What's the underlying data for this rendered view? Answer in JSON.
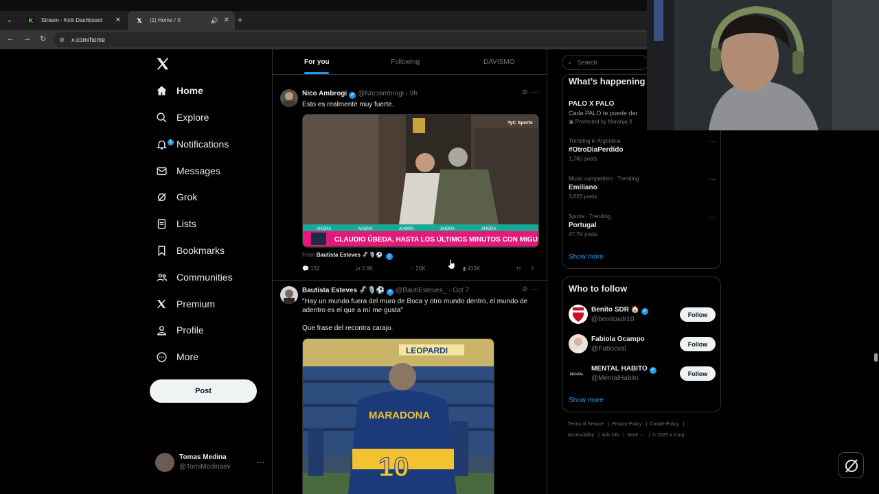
{
  "browser": {
    "tabs": [
      {
        "title": "Stream - Kick Dashboard",
        "favicon": "kick-icon"
      },
      {
        "title": "(1) Home / X",
        "favicon": "x-logo-icon",
        "active": true
      }
    ],
    "url": "x.com/home"
  },
  "sidebar": {
    "items": [
      {
        "label": "Home",
        "icon": "home-icon"
      },
      {
        "label": "Explore",
        "icon": "search-icon"
      },
      {
        "label": "Notifications",
        "icon": "bell-icon",
        "badge": "1"
      },
      {
        "label": "Messages",
        "icon": "envelope-icon"
      },
      {
        "label": "Grok",
        "icon": "grok-icon"
      },
      {
        "label": "Lists",
        "icon": "list-icon"
      },
      {
        "label": "Bookmarks",
        "icon": "bookmark-icon"
      },
      {
        "label": "Communities",
        "icon": "people-icon"
      },
      {
        "label": "Premium",
        "icon": "x-logo-icon"
      },
      {
        "label": "Profile",
        "icon": "person-icon"
      },
      {
        "label": "More",
        "icon": "more-circle-icon"
      }
    ],
    "post_label": "Post",
    "account": {
      "name": "Tomas Medina",
      "handle": "@TomiMedinaev"
    }
  },
  "feed": {
    "tabs": [
      "For you",
      "Following",
      "DAVISMO"
    ],
    "tweets": [
      {
        "name": "Nico Ambrogi",
        "handle": "@NIcoambrogi",
        "time": "9h",
        "text": "Esto es realmente muy fuerte.",
        "media_caption": "CLAUDIO ÚBEDA, HASTA LOS ÚLTIMOS MINUTOS CON MIGUEL",
        "media_ticker": "AHORA",
        "media_brand": "TyC Sports",
        "from_label": "From",
        "from_name": "Bautista Esteves 🦨🎙️⚽",
        "replies": "132",
        "reposts": "2.8K",
        "likes": "20K",
        "views": "413K"
      },
      {
        "name": "Bautista Esteves 🦨🎙️⚽",
        "handle": "@BautiEsteves_",
        "time": "Oct 7",
        "text": "\"Hay un mundo fuera del muro de Boca y otro mundo dentro, el mundo de adentro es el que a mí me gusta\"",
        "text2": "Que frase del recontra carajo.",
        "shirt_name": "MARADONA",
        "shirt_number": "10",
        "banner": "LEOPARDI"
      }
    ]
  },
  "right": {
    "search_placeholder": "Search",
    "happening_title": "What’s happening",
    "promo": {
      "title": "PALO X PALO",
      "desc": "Cada PALO te puede dar",
      "promoted": "Promoted by Naranja X"
    },
    "trends": [
      {
        "context": "Trending in Argentina",
        "title": "#OtroDiaPerdido",
        "count": "1,780 posts"
      },
      {
        "context": "Music competition · Trending",
        "title": "Emiliano",
        "count": "3,620 posts"
      },
      {
        "context": "Sports · Trending",
        "title": "Portugal",
        "count": "47.7K posts"
      }
    ],
    "show_more": "Show more",
    "who_title": "Who to follow",
    "follow_label": "Follow",
    "suggestions": [
      {
        "name": "Benito SDR 🏠",
        "handle": "@benitosdr10",
        "verified": true
      },
      {
        "name": "Fabiola Ocampo",
        "handle": "@Fabocval",
        "verified": false
      },
      {
        "name": "MENTAL HABITO",
        "handle": "@MentalHabito",
        "verified": true,
        "avatar_text": "MENTAL"
      }
    ],
    "footer": [
      "Terms of Service",
      "Privacy Policy",
      "Cookie Policy",
      "Accessibility",
      "Ads info",
      "More ···",
      "© 2025 X Corp."
    ]
  },
  "colors": {
    "accent": "#1d9bf0",
    "background": "#000000",
    "border": "#2f3336",
    "muted": "#71767b"
  }
}
